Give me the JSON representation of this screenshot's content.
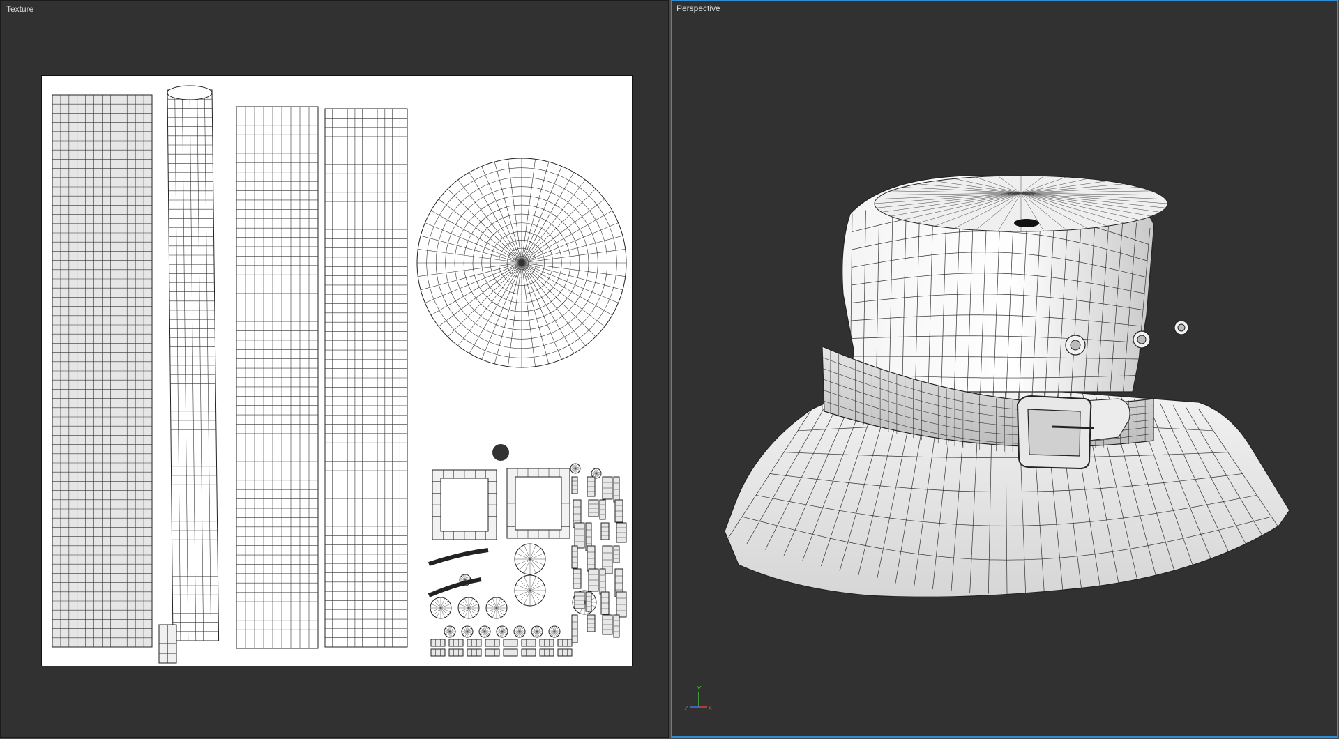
{
  "viewports": {
    "texture": {
      "label": "Texture"
    },
    "perspective": {
      "label": "Perspective"
    }
  },
  "axis_gizmo": {
    "y": "Y",
    "z": "Z",
    "x": "X"
  },
  "colors": {
    "background": "#313131",
    "active_border": "#2e8ed6",
    "uv_background": "#ffffff",
    "wire": "#222222",
    "axis_y": "#3fbf3f",
    "axis_x": "#d94040",
    "axis_z": "#4f6fd8"
  },
  "icons": [
    "axis-gizmo-icon"
  ]
}
